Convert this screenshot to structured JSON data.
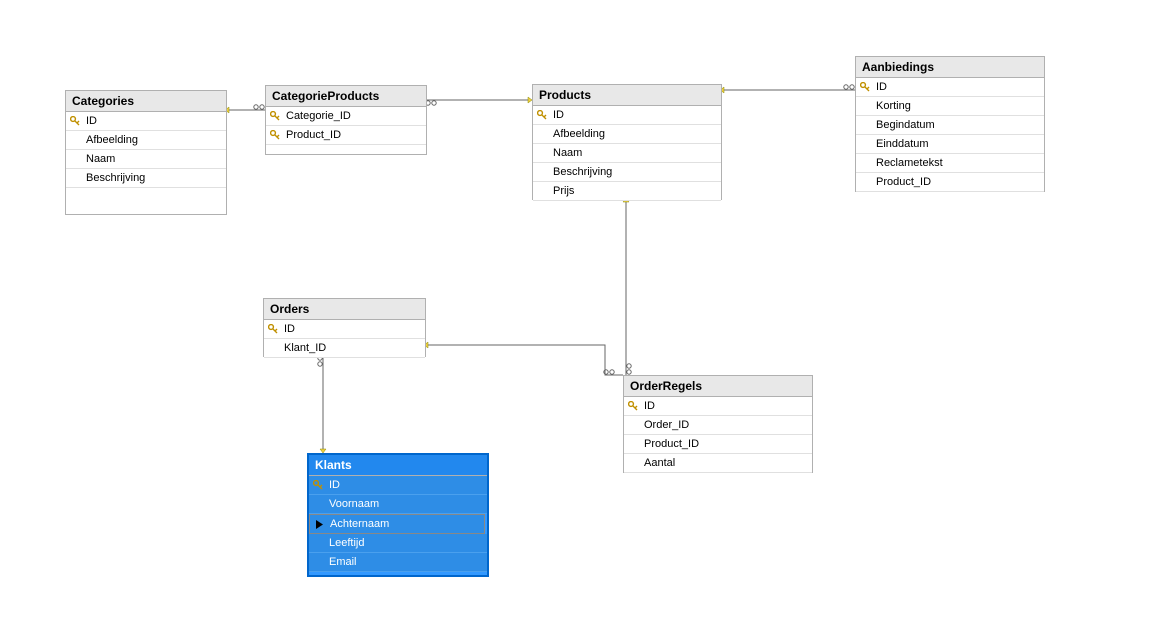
{
  "tables": {
    "categories": {
      "title": "Categories",
      "fields": [
        {
          "name": "ID",
          "key": true
        },
        {
          "name": "Afbeelding",
          "key": false
        },
        {
          "name": "Naam",
          "key": false
        },
        {
          "name": "Beschrijving",
          "key": false
        }
      ]
    },
    "categorieProducts": {
      "title": "CategorieProducts",
      "fields": [
        {
          "name": "Categorie_ID",
          "key": true
        },
        {
          "name": "Product_ID",
          "key": true
        }
      ]
    },
    "products": {
      "title": "Products",
      "fields": [
        {
          "name": "ID",
          "key": true
        },
        {
          "name": "Afbeelding",
          "key": false
        },
        {
          "name": "Naam",
          "key": false
        },
        {
          "name": "Beschrijving",
          "key": false
        },
        {
          "name": "Prijs",
          "key": false
        }
      ]
    },
    "aanbiedings": {
      "title": "Aanbiedings",
      "fields": [
        {
          "name": "ID",
          "key": true
        },
        {
          "name": "Korting",
          "key": false
        },
        {
          "name": "Begindatum",
          "key": false
        },
        {
          "name": "Einddatum",
          "key": false
        },
        {
          "name": "Reclametekst",
          "key": false
        },
        {
          "name": "Product_ID",
          "key": false
        }
      ]
    },
    "orders": {
      "title": "Orders",
      "fields": [
        {
          "name": "ID",
          "key": true
        },
        {
          "name": "Klant_ID",
          "key": false
        }
      ]
    },
    "orderRegels": {
      "title": "OrderRegels",
      "fields": [
        {
          "name": "ID",
          "key": true
        },
        {
          "name": "Order_ID",
          "key": false
        },
        {
          "name": "Product_ID",
          "key": false
        },
        {
          "name": "Aantal",
          "key": false
        }
      ]
    },
    "klants": {
      "title": "Klants",
      "fields": [
        {
          "name": "ID",
          "key": true
        },
        {
          "name": "Voornaam",
          "key": false
        },
        {
          "name": "Achternaam",
          "key": false,
          "editing": true
        },
        {
          "name": "Leeftijd",
          "key": false
        },
        {
          "name": "Email",
          "key": false
        }
      ]
    }
  }
}
